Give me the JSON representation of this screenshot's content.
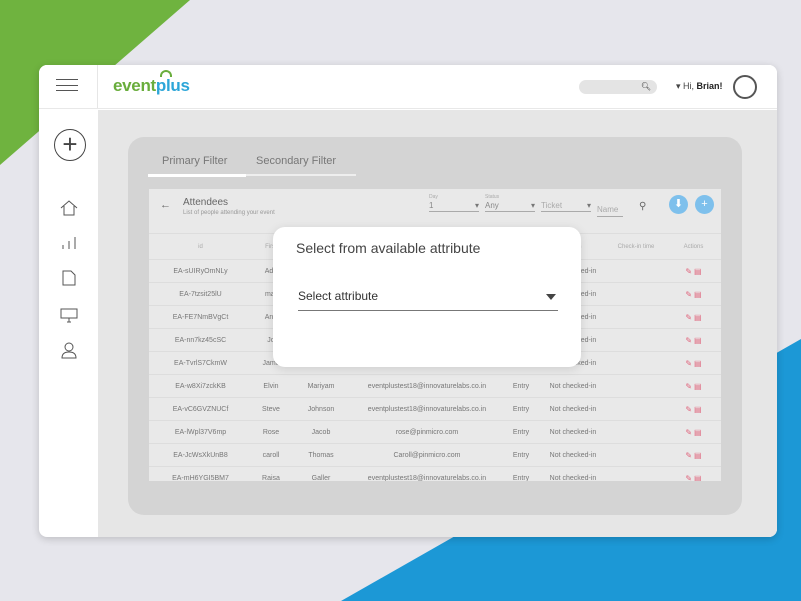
{
  "app": {
    "logo_event": "event",
    "logo_plus": "plus",
    "greeting": "Hi,",
    "user": "Brian!"
  },
  "icons": {
    "search": "search-icon",
    "menu": "hamburger-menu-icon",
    "add": "add-circle-icon",
    "home": "home-icon",
    "chart": "bar-chart-icon",
    "document": "document-icon",
    "monitor": "monitor-icon",
    "user": "user-icon",
    "back": "back-arrow-icon",
    "download": "download-icon",
    "plus": "plus-icon",
    "edit": "edit-pencil-icon",
    "delete": "trash-icon"
  },
  "tabs": [
    {
      "label": "Primary Filter"
    },
    {
      "label": "Secondary Filter"
    }
  ],
  "attendees": {
    "title": "Attendees",
    "subtitle": "List of people attending your event"
  },
  "filters": {
    "day": {
      "label": "Day",
      "value": "1"
    },
    "status": {
      "label": "Status",
      "value": "Any"
    },
    "ticket": {
      "placeholder": "Ticket"
    },
    "name": {
      "placeholder": "Name"
    }
  },
  "table": {
    "columns": [
      "id",
      "First",
      "",
      "",
      "",
      "Status",
      "Check-in time",
      "Actions"
    ],
    "rows": [
      {
        "id": "EA-sUIRyOmNLy",
        "first": "Ada",
        "last": "",
        "email": "",
        "type": "",
        "status": "Not checked-in"
      },
      {
        "id": "EA-7tzsit25lU",
        "first": "mar",
        "last": "",
        "email": "",
        "type": "",
        "status": "Not checked-in"
      },
      {
        "id": "EA-FE7NmBVgCt",
        "first": "Anu",
        "last": "",
        "email": "",
        "type": "",
        "status": "Not checked-in"
      },
      {
        "id": "EA-nn7kz45cSC",
        "first": "Jo",
        "last": "",
        "email": "",
        "type": "",
        "status": "Not checked-in"
      },
      {
        "id": "EA-TvrlS7CkmW",
        "first": "Jame",
        "last": "",
        "email": "",
        "type": "",
        "status": "Not checked-in"
      },
      {
        "id": "EA-w8Xi7zckKB",
        "first": "Elvin",
        "last": "Mariyam",
        "email": "eventplustest18@innovaturelabs.co.in",
        "type": "Entry",
        "status": "Not checked-in"
      },
      {
        "id": "EA-vC6GVZNUCf",
        "first": "Steve",
        "last": "Johnson",
        "email": "eventplustest18@innovaturelabs.co.in",
        "type": "Entry",
        "status": "Not checked-in"
      },
      {
        "id": "EA-lWpl37V6mp",
        "first": "Rose",
        "last": "Jacob",
        "email": "rose@pinmicro.com",
        "type": "Entry",
        "status": "Not checked-in"
      },
      {
        "id": "EA-JcWsXkUnB8",
        "first": "caroll",
        "last": "Thomas",
        "email": "Caroll@pinmicro.com",
        "type": "Entry",
        "status": "Not checked-in"
      },
      {
        "id": "EA-mH6YGI5BM7",
        "first": "Raisa",
        "last": "Galler",
        "email": "eventplustest18@innovaturelabs.co.in",
        "type": "Entry",
        "status": "Not checked-in"
      }
    ]
  },
  "modal": {
    "title": "Select from available attribute",
    "select_label": "Select  attribute"
  },
  "colors": {
    "green": "#6fb33f",
    "blue": "#1c98d6",
    "accent": "#7ec0ec",
    "action": "#e0657d"
  }
}
